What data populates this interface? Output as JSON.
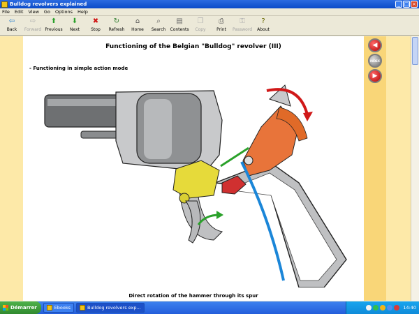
{
  "window": {
    "title": "Bulldog revolvers explained"
  },
  "menu": [
    "File",
    "Edit",
    "View",
    "Go",
    "Options",
    "Help"
  ],
  "toolbar": [
    {
      "label": "Back",
      "icon": "back-arrow-icon",
      "glyph": "⇦",
      "color": "#1e7ad0",
      "enabled": true
    },
    {
      "label": "Forward",
      "icon": "forward-arrow-icon",
      "glyph": "⇨",
      "color": "#1e7ad0",
      "enabled": false
    },
    {
      "label": "Previous",
      "icon": "up-arrow-icon",
      "glyph": "⬆",
      "color": "#2aa02a",
      "enabled": true
    },
    {
      "label": "Next",
      "icon": "down-arrow-icon",
      "glyph": "⬇",
      "color": "#2aa02a",
      "enabled": true
    },
    {
      "label": "Stop",
      "icon": "stop-icon",
      "glyph": "✖",
      "color": "#d01010",
      "enabled": true
    },
    {
      "label": "Refresh",
      "icon": "refresh-icon",
      "glyph": "↻",
      "color": "#2a7a2a",
      "enabled": true
    },
    {
      "label": "Home",
      "icon": "home-icon",
      "glyph": "⌂",
      "color": "#555555",
      "enabled": true
    },
    {
      "label": "Search",
      "icon": "search-icon",
      "glyph": "⌕",
      "color": "#555555",
      "enabled": true
    },
    {
      "label": "Contents",
      "icon": "contents-icon",
      "glyph": "▤",
      "color": "#6a6a6a",
      "enabled": true
    },
    {
      "label": "Copy",
      "icon": "copy-icon",
      "glyph": "❐",
      "color": "#8a8a8a",
      "enabled": false
    },
    {
      "label": "Print",
      "icon": "print-icon",
      "glyph": "⎙",
      "color": "#555555",
      "enabled": true
    },
    {
      "label": "Password",
      "icon": "key-icon",
      "glyph": "⚿",
      "color": "#8a8a8a",
      "enabled": false
    },
    {
      "label": "About",
      "icon": "about-icon",
      "glyph": "?",
      "color": "#6a6a00",
      "enabled": true
    }
  ],
  "page": {
    "heading": "Functioning of the Belgian \"Bulldog\" revolver (III)",
    "subheading": "- Functioning in simple action mode",
    "caption": "Direct rotation of the hammer through its spur"
  },
  "side_nav": {
    "prev_glyph": "◀",
    "index_label": "INDEX",
    "next_glyph": "▶"
  },
  "taskbar": {
    "start_label": "Démarrer",
    "tasks": [
      {
        "label": "Ebooks",
        "active": false
      },
      {
        "label": "Bulldog revolvers exp...",
        "active": true
      }
    ],
    "clock": "14:40"
  }
}
